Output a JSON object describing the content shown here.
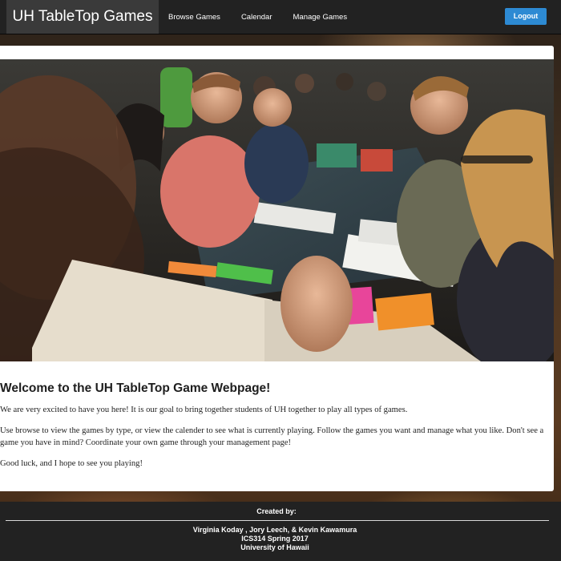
{
  "navbar": {
    "brand": "UH TableTop Games",
    "links": [
      "Browse Games",
      "Calendar",
      "Manage Games"
    ],
    "logout_label": "Logout"
  },
  "hero": {
    "icon": "photo-of-players-around-game-table"
  },
  "main": {
    "title": "Welcome to the UH TableTop Game Webpage!",
    "paragraphs": [
      "We are very excited to have you here! It is our goal to bring together students of UH together to play all types of games.",
      "Use browse to view the games by type, or view the calender to see what is currently playing. Follow the games you want and manage what you like. Don't see a game you have in mind? Coordinate your own game through your management page!",
      "Good luck, and I hope to see you playing!"
    ]
  },
  "footer": {
    "title": "Created by:",
    "lines": [
      "Virginia Koday , Jory Leech, & Kevin Kawamura",
      "ICS314 Spring 2017",
      "University of Hawaii"
    ]
  },
  "colors": {
    "navbar_bg": "#222222",
    "accent": "#2d8ad3",
    "card_bg": "#ffffff"
  }
}
